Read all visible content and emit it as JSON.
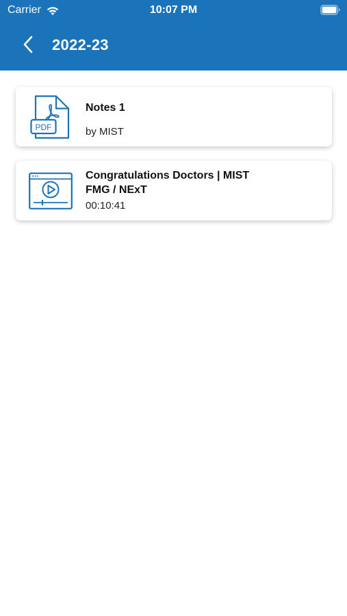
{
  "status_bar": {
    "carrier": "Carrier",
    "time": "10:07 PM",
    "icons": [
      "wifi-icon",
      "battery-icon"
    ]
  },
  "nav": {
    "title": "2022-23",
    "back_icon": "chevron-left-icon"
  },
  "colors": {
    "header_bg": "#1b73b9",
    "icon_blue": "#1b73b9"
  },
  "items": [
    {
      "type": "pdf",
      "icon": "pdf-file-icon",
      "icon_label": "PDF",
      "title": "Notes 1",
      "subtitle": "by MIST"
    },
    {
      "type": "video",
      "icon": "video-player-icon",
      "title": "Congratulations Doctors | MIST FMG / NExT",
      "subtitle": "00:10:41"
    }
  ]
}
